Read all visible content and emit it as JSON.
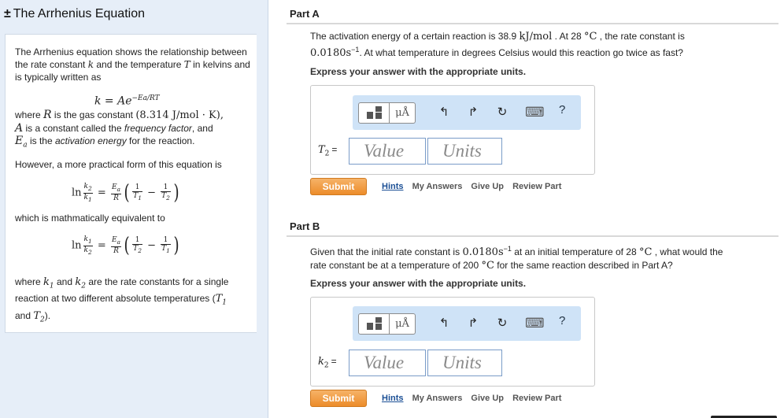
{
  "sidebar": {
    "icon": "±",
    "title": "The Arrhenius Equation",
    "intro_a": "The Arrhenius equation shows the relationship between the rate constant ",
    "intro_k": "k",
    "intro_b": " and the temperature ",
    "intro_T": "T",
    "intro_c": " in kelvins and is typically written as",
    "eq1": "k = Ae",
    "eq1_exp": "−Ea/RT",
    "where_a": "where ",
    "where_R": "R",
    "where_b": " is the gas constant ",
    "gas_const": "(8.314 J/mol · K),",
    "where_A": "A",
    "where_c": " is a constant called the ",
    "freq": "frequency factor",
    "where_d": ", and",
    "where_Ea": "E",
    "where_Ea_sub": "a",
    "where_e": " is the ",
    "act": "activation energy",
    "where_f": " for the reaction.",
    "however": "However, a more practical form of this equation is",
    "equiv": "which is mathmatically equivalent to",
    "rate_a": "where ",
    "rate_k1": "k",
    "rate_k1_sub": "1",
    "rate_b": " and ",
    "rate_k2": "k",
    "rate_k2_sub": "2",
    "rate_c": " are the rate constants for a single reaction at two different absolute temperatures (",
    "rate_T1": "T",
    "rate_T1_sub": "1",
    "rate_d": " and ",
    "rate_T2": "T",
    "rate_T2_sub": "2",
    "rate_e": ")."
  },
  "partA": {
    "title": "Part A",
    "q1": "The activation energy of a certain reaction is 38.9 ",
    "q1_unit": "kJ/mol",
    "q1_b": " . At 28  ",
    "q1_c": "°C",
    "q1_d": " , the rate constant is",
    "q2": "0.0180",
    "q2_unit": "s",
    "q2_exp": "−1",
    "q2_b": ". At what temperature in degrees Celsius would this reaction go twice as fast?",
    "express": "Express your answer with the appropriate units.",
    "var": "T",
    "var_sub": "2",
    "eq": "=",
    "value_ph": "Value",
    "units_ph": "Units",
    "submit": "Submit",
    "hints": "Hints",
    "my_answers": "My Answers",
    "give_up": "Give Up",
    "review": "Review Part"
  },
  "partB": {
    "title": "Part B",
    "q1": "Given that the initial rate constant is ",
    "q1_val": "0.0180",
    "q1_unit": "s",
    "q1_exp": "−1",
    "q1_b": " at an initial temperature of 28  ",
    "q1_c": "°C",
    "q1_d": " , what would the",
    "q2": "rate constant be at a temperature of 200  ",
    "q2_c": "°C",
    "q2_d": " for the same reaction described in Part A?",
    "express": "Express your answer with the appropriate units.",
    "var": "k",
    "var_sub": "2",
    "eq": "=",
    "value_ph": "Value",
    "units_ph": "Units",
    "submit": "Submit",
    "hints": "Hints",
    "my_answers": "My Answers",
    "give_up": "Give Up",
    "review": "Review Part"
  },
  "toolbar": {
    "mu": "μÅ",
    "undo": "↰",
    "redo": "↱",
    "reset": "↻",
    "keyboard": "⌨",
    "help": "?"
  },
  "colors": {
    "sidebar_bg": "#e6eef8",
    "toolbar_bg": "#cfe3f7",
    "submit": "#ec8c2a",
    "link": "#1b4f95"
  }
}
